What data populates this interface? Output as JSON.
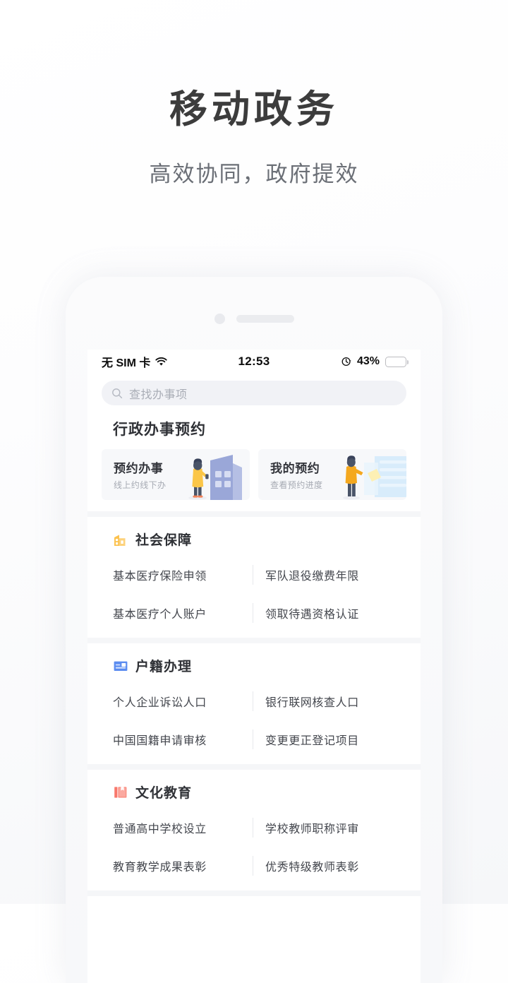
{
  "promo": {
    "title": "移动政务",
    "subtitle": "高效协同，政府提效"
  },
  "phone": {
    "status_bar": {
      "carrier": "无 SIM 卡",
      "wifi_icon": "wifi-icon",
      "time": "12:53",
      "location_icon": "location-services-icon",
      "battery_percent": "43%",
      "battery_level": 43,
      "battery_color": "#fcc419"
    },
    "search": {
      "icon": "search-icon",
      "placeholder": "查找办事项",
      "value": ""
    },
    "booking": {
      "title": "行政办事预约",
      "cards": [
        {
          "title": "预约办事",
          "subtitle": "线上约线下办",
          "illustration": "person-and-government-building-illustration",
          "accent": "#9aa7d8"
        },
        {
          "title": "我的预约",
          "subtitle": "查看预约进度",
          "illustration": "person-and-documents-illustration",
          "accent": "#bfdcf5"
        }
      ]
    },
    "categories": [
      {
        "name": "社会保障",
        "icon": "building-icon",
        "icon_color": "#fcc24f",
        "items": [
          "基本医疗保险申领",
          "军队退役缴费年限",
          "基本医疗个人账户",
          "领取待遇资格认证"
        ]
      },
      {
        "name": "户籍办理",
        "icon": "id-card-icon",
        "icon_color": "#5b8cf0",
        "items": [
          "个人企业诉讼人口",
          "银行联网核查人口",
          "中国国籍申请审核",
          "变更更正登记项目"
        ]
      },
      {
        "name": "文化教育",
        "icon": "book-icon",
        "icon_color": "#f8776b",
        "items": [
          "普通高中学校设立",
          "学校教师职称评审",
          "教育教学成果表彰",
          "优秀特级教师表彰"
        ]
      }
    ]
  }
}
